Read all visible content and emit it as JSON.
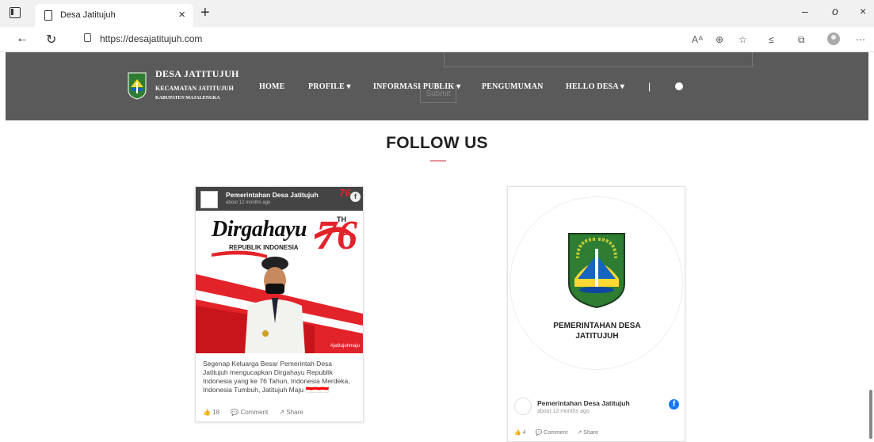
{
  "browser": {
    "tab_title": "Desa Jatitujuh",
    "tab_close": "×",
    "new_tab": "+",
    "url": "https://desajatitujuh.com",
    "window_controls": {
      "minimize": "–",
      "maximize": "o",
      "close": "×"
    },
    "toolbar_icons": [
      "read-aloud-icon",
      "zoom-icon",
      "add-favorite-icon",
      "favorites-icon",
      "collections-icon",
      "profile-icon",
      "more-icon"
    ]
  },
  "header": {
    "brand_name": "DESA JATITUJUH",
    "brand_kecamatan": "KECAMATAN JATITUJUH",
    "brand_kabupaten": "KABUPATEN MAJALENGKA",
    "ghost_submit": "Submit",
    "menu": {
      "home": "HOME",
      "profile": "PROFILE ▾",
      "informasi": "INFORMASI PUBLIK ▾",
      "pengumuman": "PENGUMUMAN",
      "hello": "HELLO DESA ▾",
      "separator": "|"
    },
    "colors": {
      "bar": "#5a5a5a",
      "text": "#ffffff"
    }
  },
  "follow": {
    "title": "FOLLOW US",
    "accent_color": "#e6949a"
  },
  "post_card": {
    "page_name": "Pemerintahan Desa Jatitujuh",
    "page_sub": "about 12 months ago",
    "poster_heading": "Dirgahayu",
    "poster_number": "76",
    "poster_num_badge": "76",
    "poster_th": "TH",
    "poster_sub": "REPUBLIK INDONESIA",
    "poster_tag": "#jatitujuhmaju",
    "text": "Segenap Keluarga Besar Pemerintah Desa Jatitujuh mengucapkan Dirgahayu Republik Indonesia yang ke 76 Tahun, Indonesia Merdeka, Indonesia Tumbuh, Jatitujuh Maju",
    "flags": "🇮🇩🇮🇩🇮🇩",
    "likes": "👍 18",
    "comment": "💬 Comment",
    "share": "↗ Share"
  },
  "page_card": {
    "caption_line1": "PEMERINTAHAN DESA",
    "caption_line2": "JATITUJUH",
    "page_name": "Pemerintahan Desa Jatitujuh",
    "time": "about 12 months ago",
    "fb_glyph": "f",
    "likes": "👍 4",
    "comment": "💬 Comment",
    "share": "↗ Share"
  }
}
